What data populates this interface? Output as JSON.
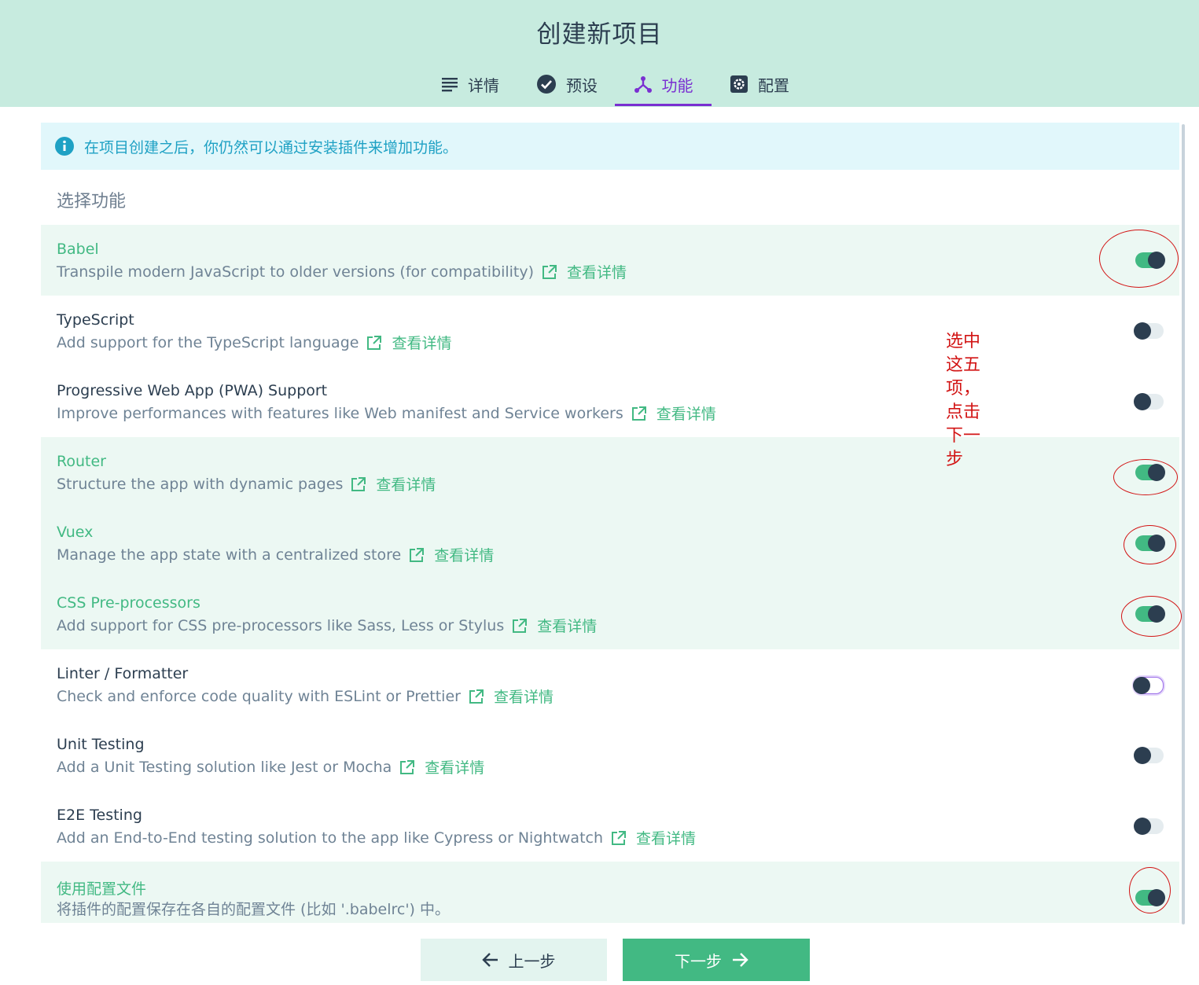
{
  "header": {
    "title": "创建新项目",
    "tabs": [
      {
        "label": "详情",
        "icon": "list-icon",
        "active": false
      },
      {
        "label": "预设",
        "icon": "check-circle-icon",
        "active": false
      },
      {
        "label": "功能",
        "icon": "fork-icon",
        "active": true
      },
      {
        "label": "配置",
        "icon": "gear-icon",
        "active": false
      }
    ]
  },
  "info": {
    "text": "在项目创建之后，你仍然可以通过安装插件来增加功能。"
  },
  "section_title": "选择功能",
  "more_label": "查看详情",
  "features": [
    {
      "name": "Babel",
      "desc": "Transpile modern JavaScript to older versions (for compatibility)",
      "enabled": true
    },
    {
      "name": "TypeScript",
      "desc": "Add support for the TypeScript language",
      "enabled": false
    },
    {
      "name": "Progressive Web App (PWA) Support",
      "desc": "Improve performances with features like Web manifest and Service workers",
      "enabled": false
    },
    {
      "name": "Router",
      "desc": "Structure the app with dynamic pages",
      "enabled": true
    },
    {
      "name": "Vuex",
      "desc": "Manage the app state with a centralized store",
      "enabled": true
    },
    {
      "name": "CSS Pre-processors",
      "desc": "Add support for CSS pre-processors like Sass, Less or Stylus",
      "enabled": true
    },
    {
      "name": "Linter / Formatter",
      "desc": "Check and enforce code quality with ESLint or Prettier",
      "enabled": false
    },
    {
      "name": "Unit Testing",
      "desc": "Add a Unit Testing solution like Jest or Mocha",
      "enabled": false
    },
    {
      "name": "E2E Testing",
      "desc": "Add an End-to-End testing solution to the app like Cypress or Nightwatch",
      "enabled": false
    }
  ],
  "config_file": {
    "name": "使用配置文件",
    "desc": "将插件的配置保存在各自的配置文件 (比如 '.babelrc') 中。",
    "enabled": true
  },
  "annotation": {
    "text": "选中这五项，点击下一步",
    "color": "#d21414"
  },
  "buttons": {
    "prev": "上一步",
    "next": "下一步"
  },
  "colors": {
    "accent": "#42b983",
    "header_bg": "#c7ebdf",
    "active_tab": "#7a2fd1",
    "info": "#1fa1c4"
  }
}
